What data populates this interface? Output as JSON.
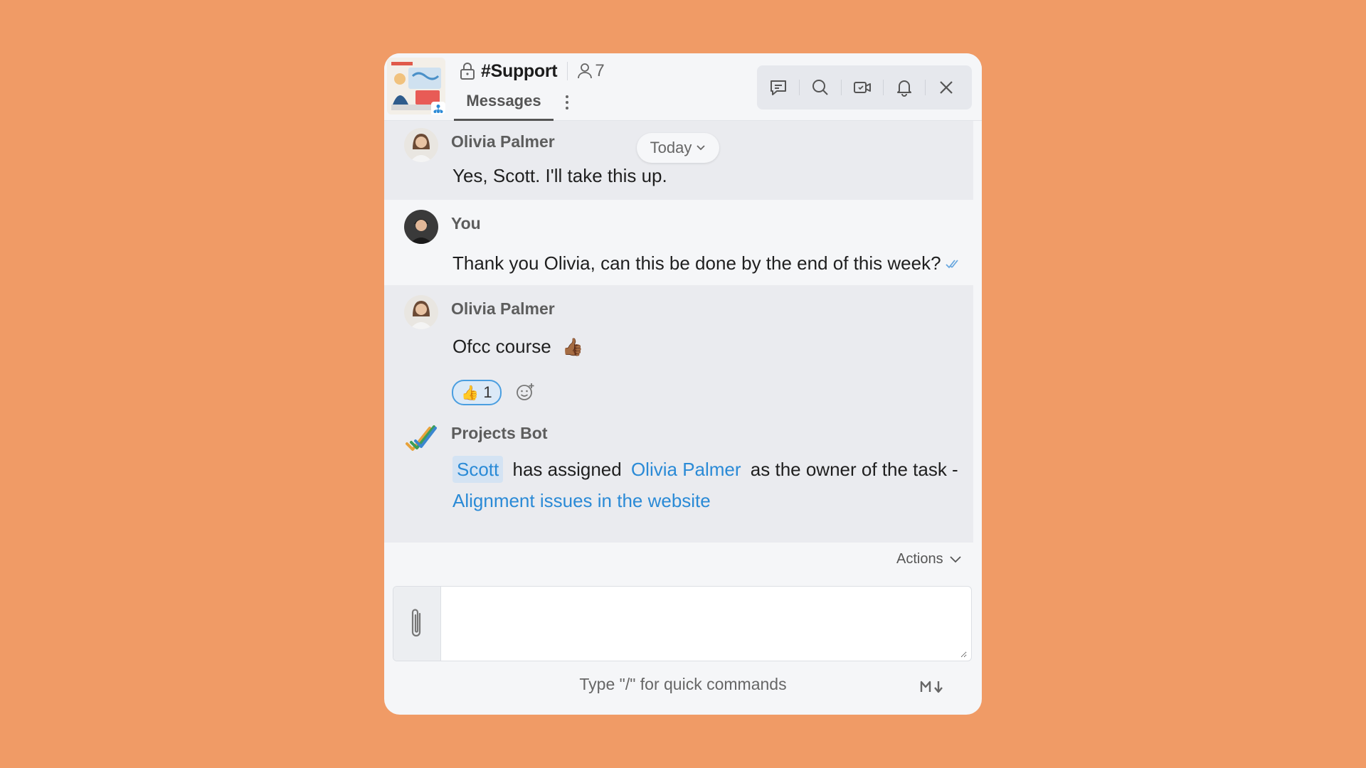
{
  "header": {
    "channel_name": "#Support",
    "member_count": "7",
    "tab_label": "Messages",
    "toolbar_icons": [
      "chat-icon",
      "search-icon",
      "video-icon",
      "bell-icon",
      "close-icon"
    ]
  },
  "date_pill": "Today",
  "messages": [
    {
      "sender": "Olivia Palmer",
      "text": "Yes, Scott. I'll take this up."
    },
    {
      "sender": "You",
      "text": "Thank you Olivia, can this be done by the end of this week?"
    },
    {
      "sender": "Olivia Palmer",
      "text": "Ofcc course",
      "emoji": "👍🏾",
      "reaction": {
        "emoji": "👍",
        "count": "1"
      }
    },
    {
      "sender": "Projects Bot",
      "mention": "Scott",
      "text_1": "has assigned",
      "assignee": "Olivia Palmer",
      "text_2": "as the owner of the task -",
      "task_link": "Alignment issues in the website"
    }
  ],
  "actions_label": "Actions",
  "composer": {
    "placeholder": "",
    "hint": "Type \"/\" for quick commands"
  },
  "colors": {
    "background": "#f09b66",
    "link": "#2a8ad6",
    "reaction_border": "#4a9ee0"
  }
}
